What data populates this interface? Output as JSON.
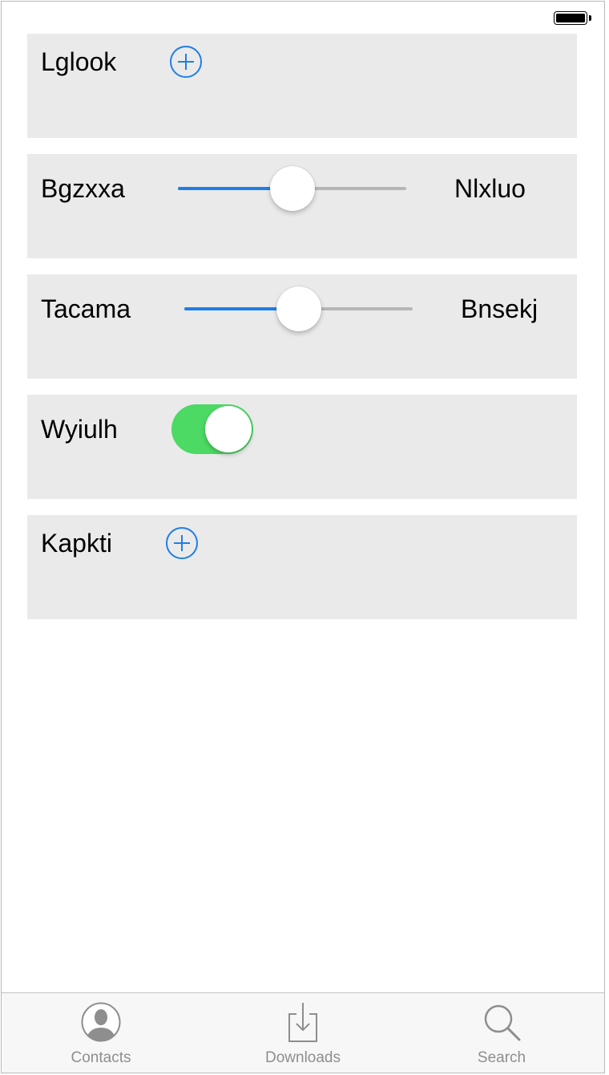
{
  "status_bar": {
    "battery_icon": "battery-full-icon"
  },
  "rows": [
    {
      "label": "Lglook",
      "control": "add-button",
      "icon": "plus-circle-icon"
    },
    {
      "label": "Bgzxxa",
      "control": "slider",
      "value_label": "Nlxluo",
      "slider_value": 0.5
    },
    {
      "label": "Tacama",
      "control": "slider",
      "value_label": "Bnsekj",
      "slider_value": 0.5
    },
    {
      "label": "Wyiulh",
      "control": "toggle",
      "toggle_on": true
    },
    {
      "label": "Kapkti",
      "control": "add-button",
      "icon": "plus-circle-icon"
    }
  ],
  "tab_bar": {
    "tabs": [
      {
        "label": "Contacts",
        "icon": "contacts-icon"
      },
      {
        "label": "Downloads",
        "icon": "downloads-icon"
      },
      {
        "label": "Search",
        "icon": "search-icon"
      }
    ]
  },
  "colors": {
    "accent": "#1f7ee6",
    "toggle_on": "#4cd964",
    "row_background": "#eaeaea",
    "tab_label": "#8e8e8e"
  }
}
